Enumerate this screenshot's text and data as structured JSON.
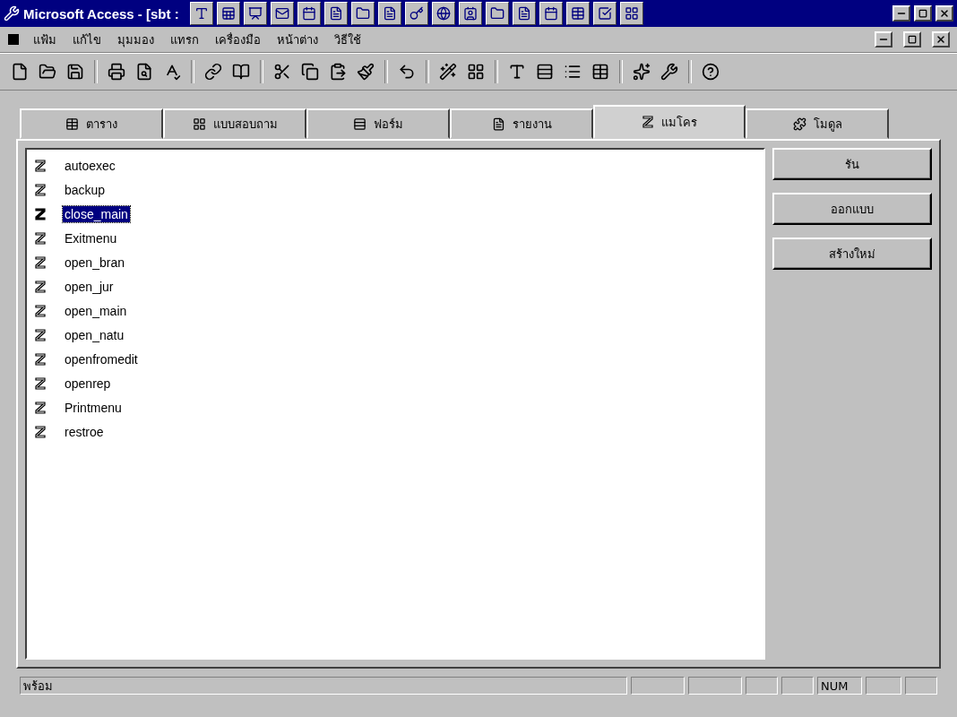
{
  "window": {
    "title": "Microsoft Access - [sbt :"
  },
  "menu_bar": {
    "items": [
      "แฟ้ม",
      "แก้ไข",
      "มุมมอง",
      "แทรก",
      "เครื่องมือ",
      "หน้าต่าง",
      "วิธีใช้"
    ]
  },
  "tabs": [
    {
      "label": "ตาราง",
      "selected": false
    },
    {
      "label": "แบบสอบถาม",
      "selected": false
    },
    {
      "label": "ฟอร์ม",
      "selected": false
    },
    {
      "label": "รายงาน",
      "selected": false
    },
    {
      "label": "แมโคร",
      "selected": true
    },
    {
      "label": "โมดูล",
      "selected": false
    }
  ],
  "macros": [
    {
      "name": "autoexec",
      "selected": false
    },
    {
      "name": "backup",
      "selected": false
    },
    {
      "name": "close_main",
      "selected": true
    },
    {
      "name": "Exitmenu",
      "selected": false
    },
    {
      "name": "open_bran",
      "selected": false
    },
    {
      "name": "open_jur",
      "selected": false
    },
    {
      "name": "open_main",
      "selected": false
    },
    {
      "name": "open_natu",
      "selected": false
    },
    {
      "name": "openfromedit",
      "selected": false
    },
    {
      "name": "openrep",
      "selected": false
    },
    {
      "name": "Printmenu",
      "selected": false
    },
    {
      "name": "restroe",
      "selected": false
    }
  ],
  "buttons": [
    "รัน",
    "ออกแบบ",
    "สร้างใหม่"
  ],
  "status_bar": {
    "message": "พร้อม",
    "indicators": [
      "NUM"
    ]
  }
}
